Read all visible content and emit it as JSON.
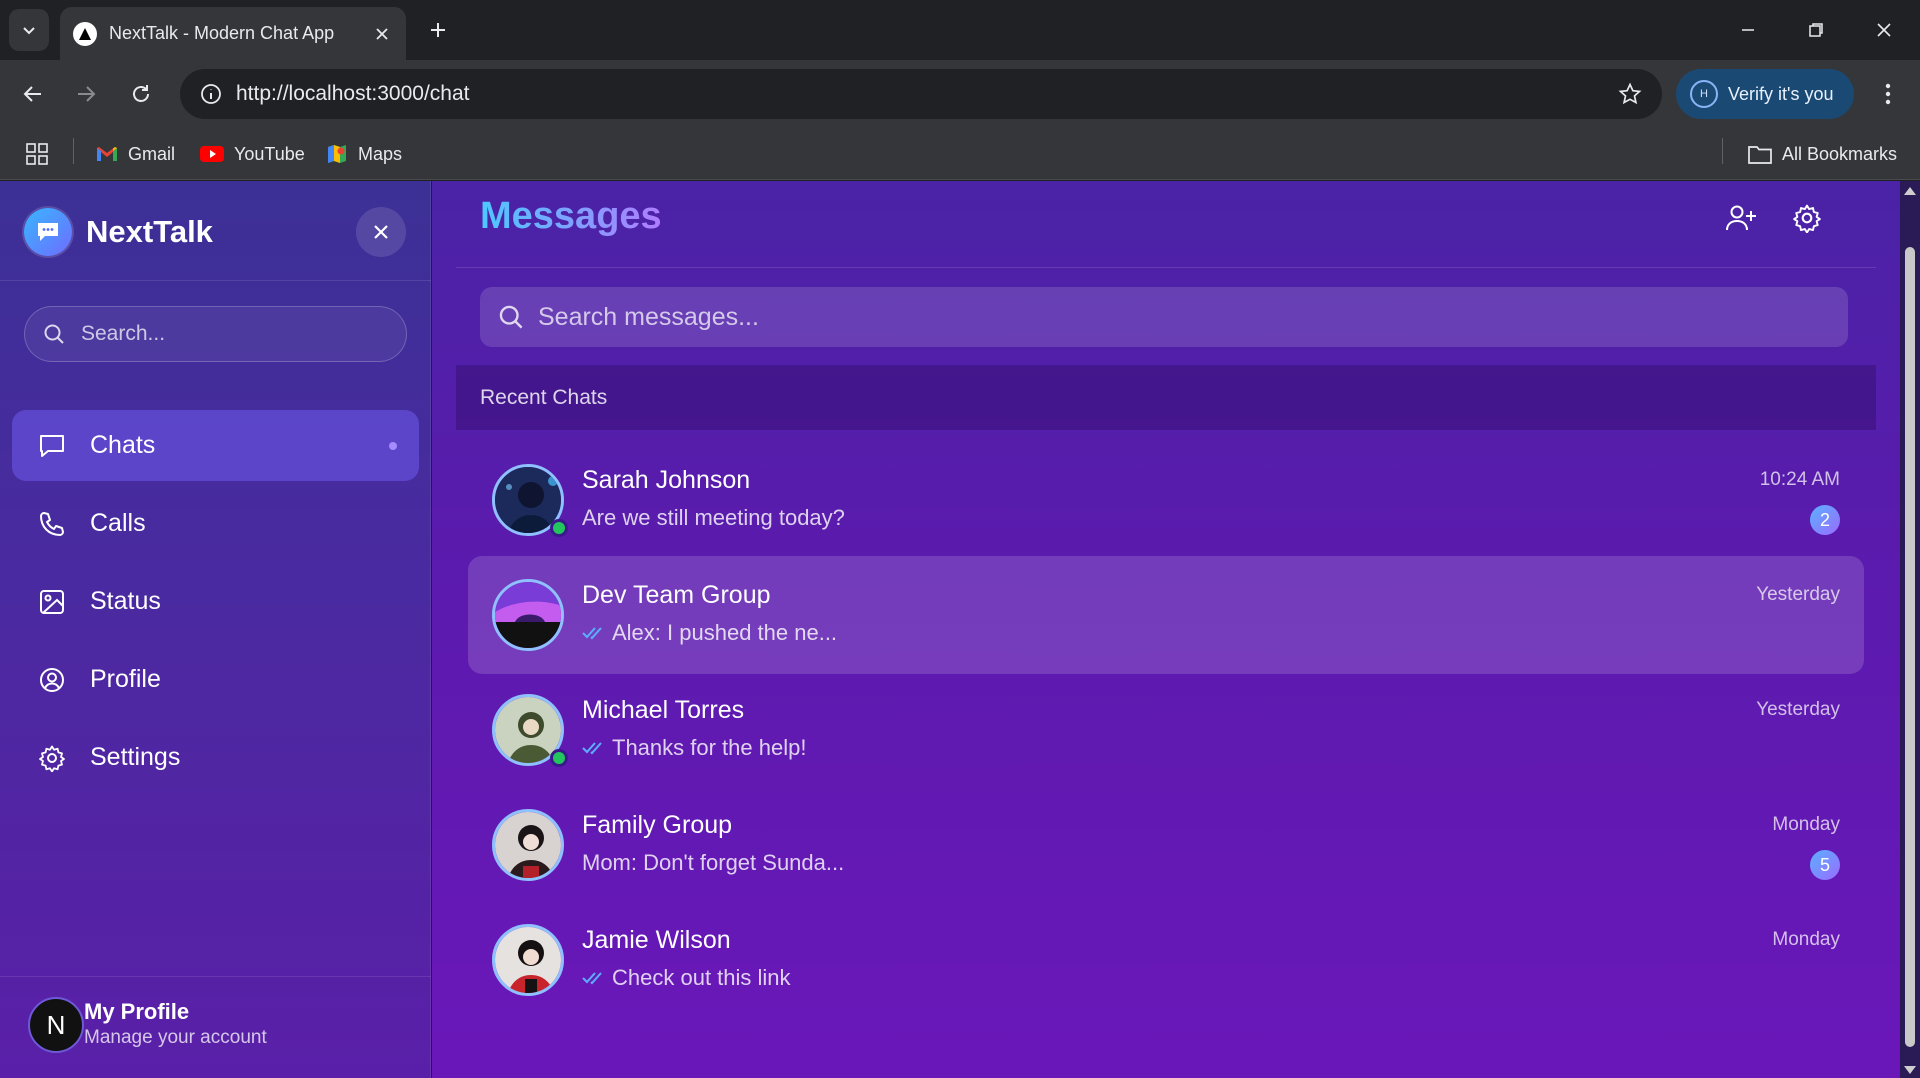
{
  "browser": {
    "tab_title": "NextTalk - Modern Chat App",
    "url": "http://localhost:3000/chat",
    "verify_label": "Verify it's you",
    "verify_initial": "H",
    "bookmarks": [
      {
        "label": "Gmail",
        "icon": "gmail-icon"
      },
      {
        "label": "YouTube",
        "icon": "youtube-icon"
      },
      {
        "label": "Maps",
        "icon": "maps-icon"
      }
    ],
    "all_bookmarks": "All Bookmarks"
  },
  "sidebar": {
    "app_name": "NextTalk",
    "search_placeholder": "Search...",
    "nav": [
      {
        "label": "Chats",
        "icon": "message-square-icon",
        "active": true
      },
      {
        "label": "Calls",
        "icon": "phone-icon",
        "active": false
      },
      {
        "label": "Status",
        "icon": "image-icon",
        "active": false
      },
      {
        "label": "Profile",
        "icon": "user-circle-icon",
        "active": false
      },
      {
        "label": "Settings",
        "icon": "gear-icon",
        "active": false
      }
    ],
    "profile": {
      "initial": "N",
      "name": "My Profile",
      "subtitle": "Manage your account"
    }
  },
  "main": {
    "title": "Messages",
    "search_placeholder": "Search messages...",
    "section_label": "Recent Chats",
    "chats": [
      {
        "name": "Sarah Johnson",
        "preview": "Are we still meeting today?",
        "time": "10:24 AM",
        "unread": "2",
        "online": true,
        "read_tick": false,
        "selected": false
      },
      {
        "name": "Dev Team Group",
        "preview": "Alex: I pushed the ne...",
        "time": "Yesterday",
        "unread": null,
        "online": false,
        "read_tick": true,
        "selected": true
      },
      {
        "name": "Michael Torres",
        "preview": "Thanks for the help!",
        "time": "Yesterday",
        "unread": null,
        "online": true,
        "read_tick": true,
        "selected": false
      },
      {
        "name": "Family Group",
        "preview": "Mom: Don't forget Sunda...",
        "time": "Monday",
        "unread": "5",
        "online": false,
        "read_tick": false,
        "selected": false
      },
      {
        "name": "Jamie Wilson",
        "preview": "Check out this link",
        "time": "Monday",
        "unread": null,
        "online": false,
        "read_tick": true,
        "selected": false
      }
    ]
  },
  "colors": {
    "accent": "#7c5cff",
    "online": "#22c55e",
    "tick": "#5ab0ff"
  }
}
